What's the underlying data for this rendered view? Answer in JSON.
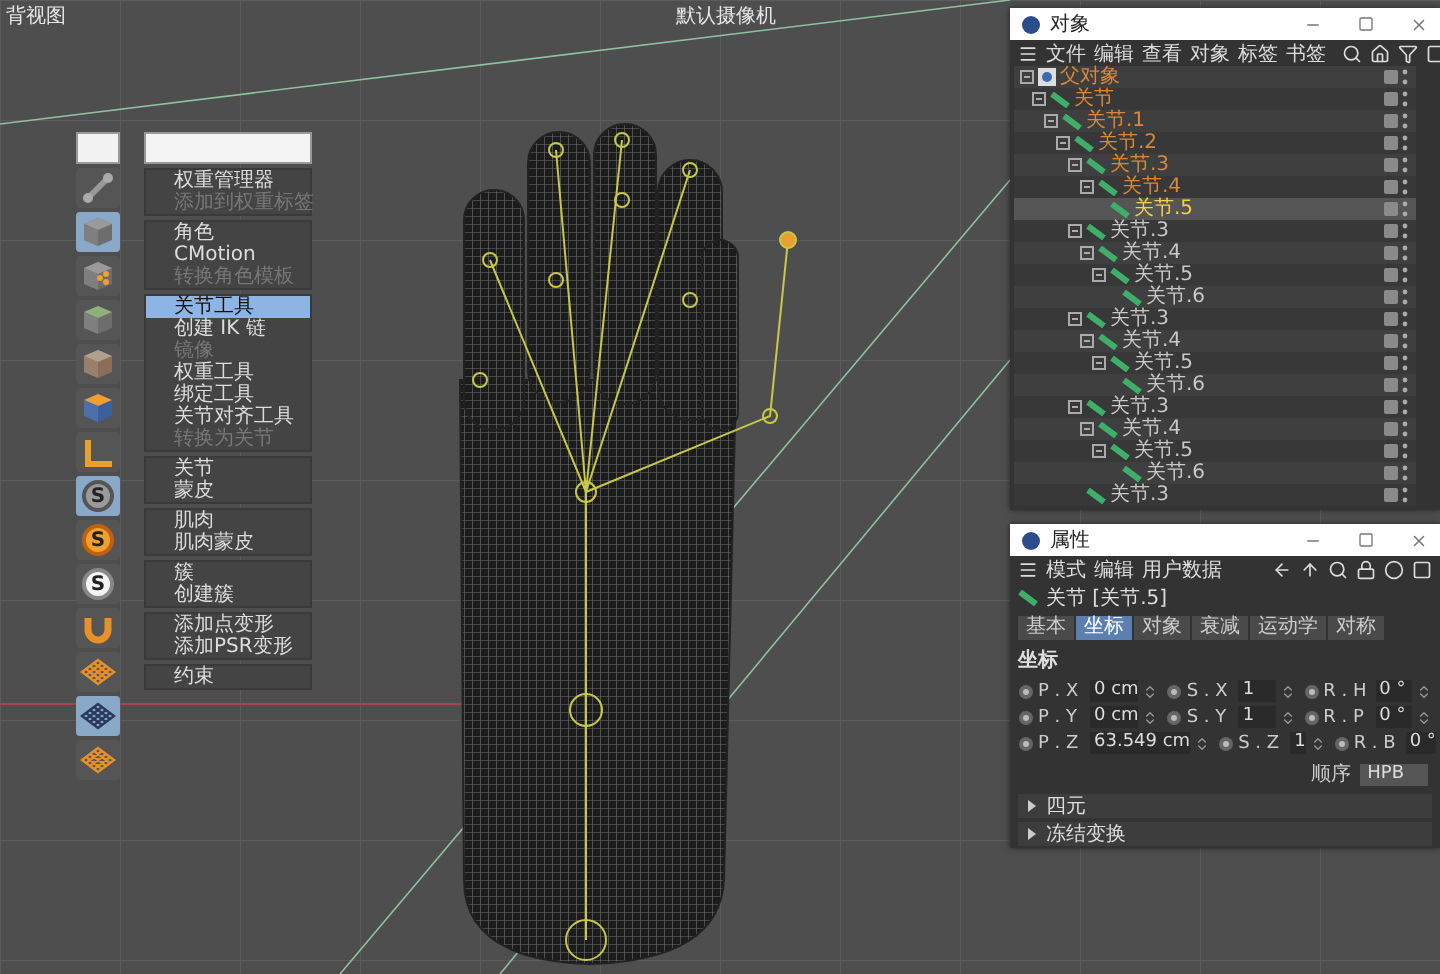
{
  "viewport": {
    "view_label": "背视图",
    "camera_label": "默认摄像机"
  },
  "palette": [
    {
      "kind": "joint",
      "selected": false
    },
    {
      "kind": "cube",
      "selected": true
    },
    {
      "kind": "cube-dots",
      "selected": false
    },
    {
      "kind": "cube-green",
      "selected": false
    },
    {
      "kind": "cube-flat",
      "selected": false
    },
    {
      "kind": "cube-orange",
      "selected": false
    },
    {
      "kind": "angle",
      "selected": false
    },
    {
      "kind": "badge-grey",
      "glyph": "S",
      "selected": true
    },
    {
      "kind": "badge-orange",
      "glyph": "S",
      "selected": false
    },
    {
      "kind": "badge-white",
      "glyph": "S",
      "selected": false
    },
    {
      "kind": "magnet",
      "selected": false
    },
    {
      "kind": "lattice-orange",
      "selected": false
    },
    {
      "kind": "lattice-blue",
      "selected": true
    },
    {
      "kind": "lattice-dark",
      "selected": false
    }
  ],
  "menu_groups": [
    {
      "items": [
        {
          "label": "权重管理器",
          "disabled": false,
          "selected": false
        },
        {
          "label": "添加到权重标签",
          "disabled": true,
          "selected": false
        }
      ]
    },
    {
      "items": [
        {
          "label": "角色",
          "disabled": false,
          "selected": false
        },
        {
          "label": "CMotion",
          "disabled": false,
          "selected": false
        },
        {
          "label": "转换角色模板",
          "disabled": true,
          "selected": false
        }
      ]
    },
    {
      "items": [
        {
          "label": "关节工具",
          "disabled": false,
          "selected": true
        },
        {
          "label": "创建 IK 链",
          "disabled": false,
          "selected": false
        },
        {
          "label": "镜像",
          "disabled": true,
          "selected": false
        },
        {
          "label": "权重工具",
          "disabled": false,
          "selected": false
        },
        {
          "label": "绑定工具",
          "disabled": false,
          "selected": false
        },
        {
          "label": "关节对齐工具",
          "disabled": false,
          "selected": false
        },
        {
          "label": "转换为关节",
          "disabled": true,
          "selected": false
        }
      ]
    },
    {
      "items": [
        {
          "label": "关节",
          "disabled": false,
          "selected": false
        },
        {
          "label": "蒙皮",
          "disabled": false,
          "selected": false
        }
      ]
    },
    {
      "items": [
        {
          "label": "肌肉",
          "disabled": false,
          "selected": false
        },
        {
          "label": "肌肉蒙皮",
          "disabled": false,
          "selected": false
        }
      ]
    },
    {
      "items": [
        {
          "label": "簇",
          "disabled": false,
          "selected": false
        },
        {
          "label": "创建簇",
          "disabled": false,
          "selected": false
        }
      ]
    },
    {
      "items": [
        {
          "label": "添加点变形",
          "disabled": false,
          "selected": false
        },
        {
          "label": "添加PSR变形",
          "disabled": false,
          "selected": false
        }
      ]
    },
    {
      "items": [
        {
          "label": "约束",
          "disabled": false,
          "selected": false
        }
      ]
    }
  ],
  "object_panel": {
    "title": "对象",
    "menu": [
      "文件",
      "编辑",
      "查看",
      "对象",
      "标签",
      "书签"
    ],
    "objects": [
      {
        "label": "父对象",
        "selected": false,
        "on_path": true,
        "children": [
          {
            "label": "关节",
            "selected": false,
            "on_path": true,
            "children": [
              {
                "label": "关节.1",
                "selected": false,
                "on_path": true,
                "children": [
                  {
                    "label": "关节.2",
                    "selected": false,
                    "on_path": true,
                    "children": [
                      {
                        "label": "关节.3",
                        "selected": false,
                        "on_path": true,
                        "children": [
                          {
                            "label": "关节.4",
                            "selected": false,
                            "on_path": true,
                            "children": [
                              {
                                "label": "关节.5",
                                "selected": true,
                                "on_path": false
                              }
                            ]
                          }
                        ]
                      },
                      {
                        "label": "关节.3",
                        "selected": false,
                        "on_path": false,
                        "children": [
                          {
                            "label": "关节.4",
                            "selected": false,
                            "on_path": false,
                            "children": [
                              {
                                "label": "关节.5",
                                "selected": false,
                                "on_path": false,
                                "children": [
                                  {
                                    "label": "关节.6",
                                    "selected": false,
                                    "on_path": false
                                  }
                                ]
                              }
                            ]
                          }
                        ]
                      },
                      {
                        "label": "关节.3",
                        "selected": false,
                        "on_path": false,
                        "children": [
                          {
                            "label": "关节.4",
                            "selected": false,
                            "on_path": false,
                            "children": [
                              {
                                "label": "关节.5",
                                "selected": false,
                                "on_path": false,
                                "children": [
                                  {
                                    "label": "关节.6",
                                    "selected": false,
                                    "on_path": false
                                  }
                                ]
                              }
                            ]
                          }
                        ]
                      },
                      {
                        "label": "关节.3",
                        "selected": false,
                        "on_path": false,
                        "children": [
                          {
                            "label": "关节.4",
                            "selected": false,
                            "on_path": false,
                            "children": [
                              {
                                "label": "关节.5",
                                "selected": false,
                                "on_path": false,
                                "children": [
                                  {
                                    "label": "关节.6",
                                    "selected": false,
                                    "on_path": false
                                  }
                                ]
                              }
                            ]
                          }
                        ]
                      },
                      {
                        "label": "关节.3",
                        "selected": false,
                        "on_path": false
                      }
                    ]
                  }
                ]
              }
            ]
          }
        ]
      }
    ]
  },
  "attribute_panel": {
    "title": "属性",
    "menu": [
      "模式",
      "编辑",
      "用户数据"
    ],
    "header": "关节 [关节.5]",
    "tabs": [
      {
        "label": "基本",
        "selected": false
      },
      {
        "label": "坐标",
        "selected": true
      },
      {
        "label": "对象",
        "selected": false
      },
      {
        "label": "衰减",
        "selected": false
      },
      {
        "label": "运动学",
        "selected": false
      },
      {
        "label": "对称",
        "selected": false
      }
    ],
    "section": "坐标",
    "rows": [
      {
        "fields": [
          {
            "label": "P . X",
            "value": "0 cm"
          },
          {
            "label": "S . X",
            "value": "1"
          },
          {
            "label": "R . H",
            "value": "0 °"
          }
        ]
      },
      {
        "fields": [
          {
            "label": "P . Y",
            "value": "0 cm"
          },
          {
            "label": "S . Y",
            "value": "1"
          },
          {
            "label": "R . P",
            "value": "0 °"
          }
        ]
      },
      {
        "fields": [
          {
            "label": "P . Z",
            "value": "63.549 cm"
          },
          {
            "label": "S . Z",
            "value": "1"
          },
          {
            "label": "R . B",
            "value": "0 °"
          }
        ]
      }
    ],
    "order_label": "顺序",
    "order_value": "HPB",
    "groups": [
      {
        "label": "四元",
        "expanded": false
      },
      {
        "label": "冻结变换",
        "expanded": false
      }
    ]
  }
}
